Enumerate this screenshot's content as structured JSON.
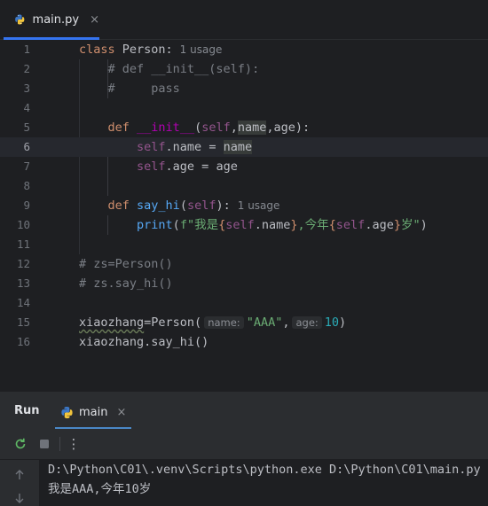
{
  "editor_tab": {
    "label": "main.py",
    "close": "×"
  },
  "line_numbers": [
    "1",
    "2",
    "3",
    "4",
    "5",
    "6",
    "7",
    "8",
    "9",
    "10",
    "11",
    "12",
    "13",
    "14",
    "15",
    "16"
  ],
  "code": {
    "l1_kw": "class",
    "l1_name": " Person:",
    "l1_usage": "1 usage",
    "l2": "    # def __init__(self):",
    "l3": "    #     pass",
    "l5_kw": "    def",
    "l5_fn": "__init__",
    "l5_open": "(",
    "l5_self": "self",
    "l5_comma": ",",
    "l5_name": "name",
    "l5_rest": ",age):",
    "l6_self": "        self",
    "l6_mid": ".name = ",
    "l6_name": "name",
    "l7_self": "        self",
    "l7_rest": ".age = age",
    "l9_kw": "    def",
    "l9_fn": "say_hi",
    "l9_open": "(",
    "l9_self": "self",
    "l9_close": "):",
    "l9_usage": "1 usage",
    "l10_indent": "        ",
    "l10_print": "print",
    "l10_open": "(",
    "l10_fprefix": "f\"我是",
    "l10_brace1": "{",
    "l10_self1": "self",
    "l10_name": ".name",
    "l10_brace2": "}",
    "l10_mid": ",今年",
    "l10_brace3": "{",
    "l10_self2": "self",
    "l10_age": ".age",
    "l10_brace4": "}",
    "l10_end": "岁\"",
    "l10_close": ")",
    "l12": "# zs=Person()",
    "l13": "# zs.say_hi()",
    "l15_var": "xiaozhang",
    "l15_call": "=Person(",
    "l15_hint1": "name:",
    "l15_str": "\"AAA\"",
    "l15_comma": ",",
    "l15_hint2": "age:",
    "l15_num": "10",
    "l15_close": ")",
    "l16": "xiaozhang.say_hi()"
  },
  "run_panel": {
    "title": "Run",
    "tab_label": "main",
    "tab_close": "×",
    "toolbar_more": "⋮",
    "command": "D:\\Python\\C01\\.venv\\Scripts\\python.exe D:\\Python\\C01\\main.py",
    "output": "我是AAA,今年10岁"
  },
  "icons": {
    "file_icon": "python-icon",
    "rerun": "rerun-icon",
    "stop": "stop-icon",
    "scroll_up": "arrow-up-icon",
    "scroll_down": "arrow-down-icon"
  },
  "colors": {
    "background": "#1e1f22",
    "panel": "#2b2d30",
    "keyword": "#cf8e6d",
    "function": "#56a8f5",
    "dunder": "#b200b2",
    "self": "#94558d",
    "string": "#6aab73",
    "number": "#2aacb8",
    "comment": "#7a7e85",
    "accent": "#3574f0"
  }
}
